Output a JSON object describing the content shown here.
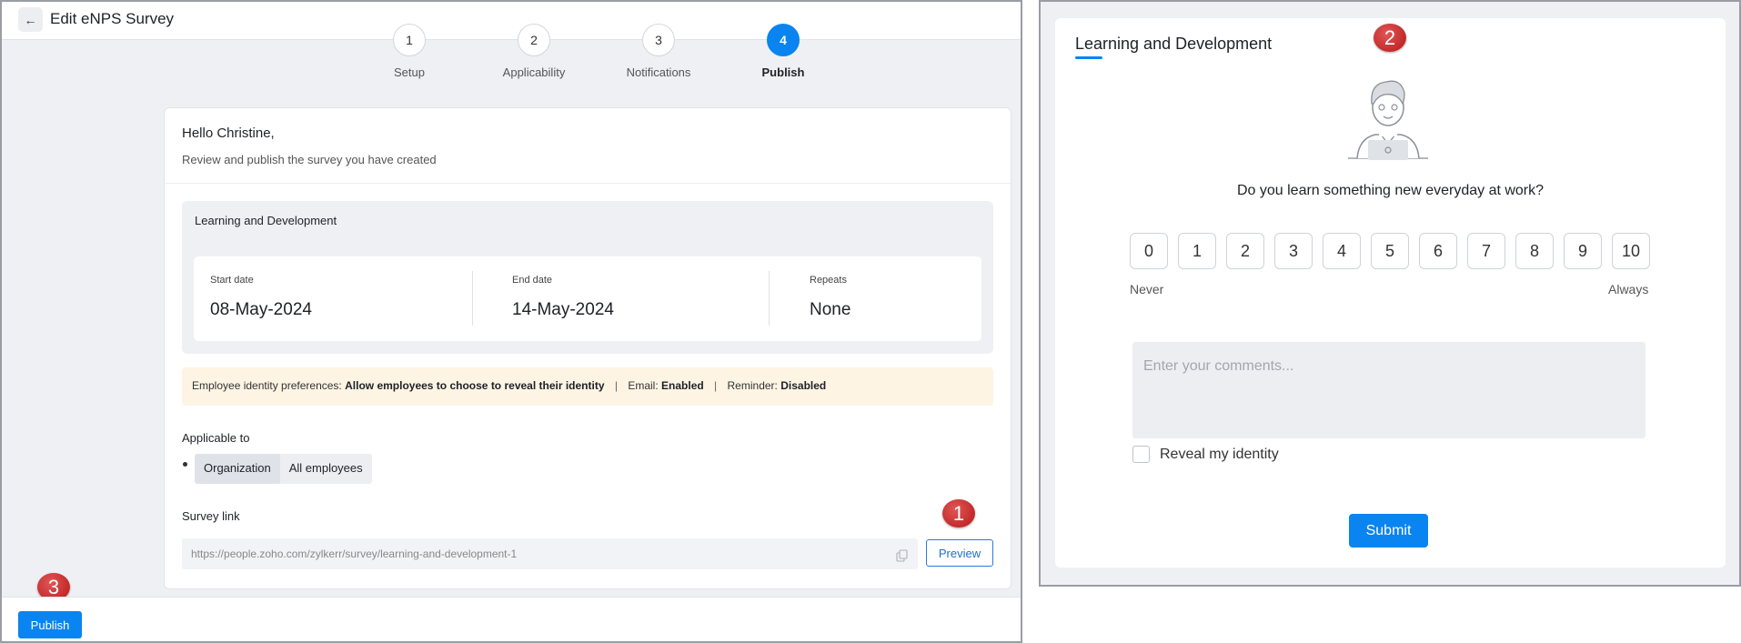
{
  "header": {
    "title": "Edit eNPS Survey",
    "back_icon": "arrow-left-icon"
  },
  "steps": [
    {
      "number": "1",
      "label": "Setup",
      "active": false
    },
    {
      "number": "2",
      "label": "Applicability",
      "active": false
    },
    {
      "number": "3",
      "label": "Notifications",
      "active": false
    },
    {
      "number": "4",
      "label": "Publish",
      "active": true
    }
  ],
  "review": {
    "greeting": "Hello Christine,",
    "subtitle": "Review and publish the survey you have created",
    "survey_name": "Learning and Development",
    "start_label": "Start date",
    "start_value": "08-May-2024",
    "end_label": "End date",
    "end_value": "14-May-2024",
    "repeats_label": "Repeats",
    "repeats_value": "None"
  },
  "identity": {
    "prefix": "Employee identity preferences:",
    "preference": "Allow employees to choose to reveal their identity",
    "separator": "|",
    "email_label": "Email:",
    "email_value": "Enabled",
    "reminder_label": "Reminder:",
    "reminder_value": "Disabled"
  },
  "applicable": {
    "title": "Applicable to",
    "chip_1": "Organization",
    "chip_2": "All employees"
  },
  "survey_link": {
    "title": "Survey link",
    "url": "https://people.zoho.com/zylkerr/survey/learning-and-development-1",
    "preview_label": "Preview"
  },
  "footer": {
    "publish_label": "Publish"
  },
  "markers": {
    "one": "1",
    "two": "2",
    "three": "3"
  },
  "form": {
    "title": "Learning and Development",
    "question": "Do you learn something new everyday at work?",
    "scale": [
      "0",
      "1",
      "2",
      "3",
      "4",
      "5",
      "6",
      "7",
      "8",
      "9",
      "10"
    ],
    "scale_min_label": "Never",
    "scale_max_label": "Always",
    "comments_placeholder": "Enter your comments...",
    "reveal_label": "Reveal my identity",
    "submit_label": "Submit"
  },
  "colors": {
    "accent": "#0a84f0",
    "marker": "#c42a2a",
    "identity_bg": "#fdf4e4"
  }
}
